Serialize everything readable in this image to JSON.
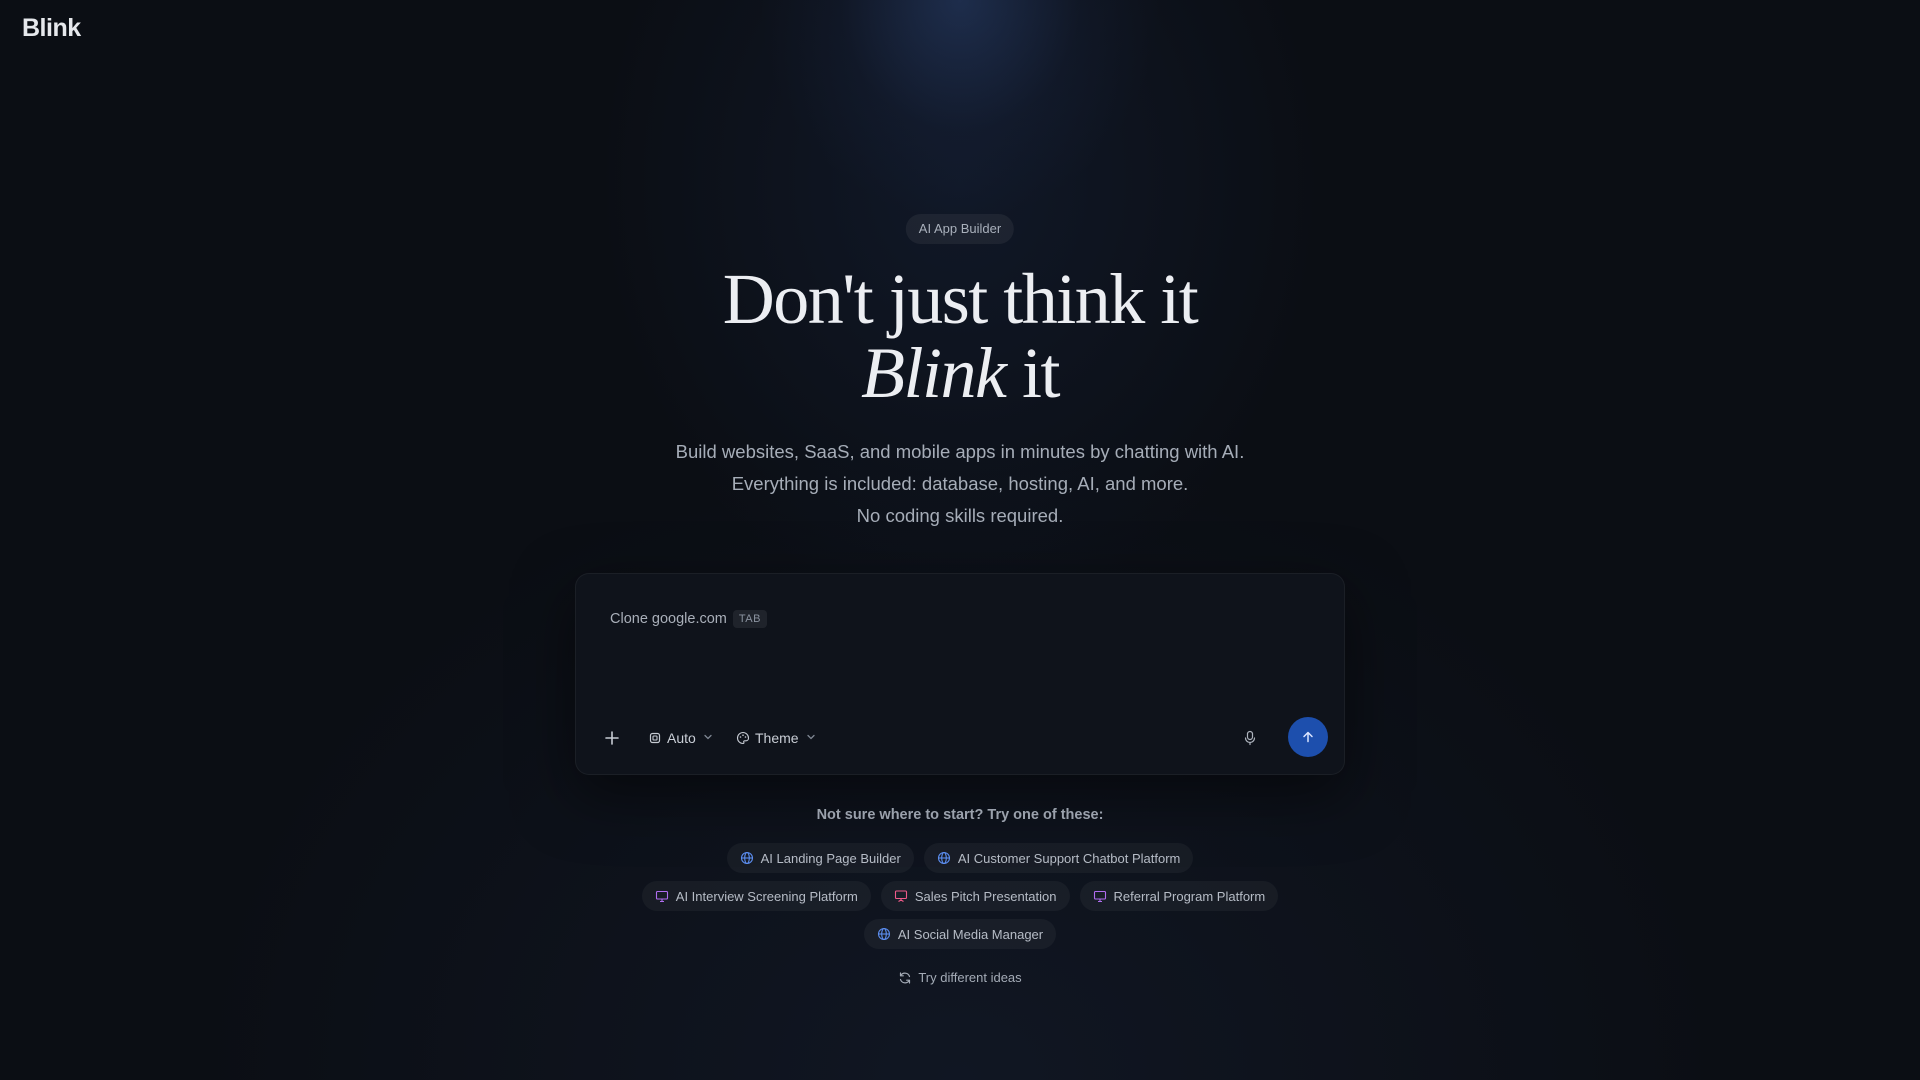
{
  "app": {
    "logo": "Blink"
  },
  "hero": {
    "badge": "AI App Builder",
    "headline_line1": "Don't just think it",
    "headline_line2_italic": "Blink",
    "headline_line2_rest": " it",
    "subtitle_lines": [
      "Build websites, SaaS, and mobile apps in minutes by chatting with AI.",
      "Everything is included: database, hosting, AI, and more.",
      "No coding skills required."
    ]
  },
  "composer": {
    "placeholder": "Clone google.com",
    "tab_hint": "TAB",
    "model_label": "Auto",
    "theme_label": "Theme",
    "accent_color": "#1d4fad",
    "icons": [
      "plus-icon",
      "cpu-icon",
      "palette-icon",
      "microphone-icon",
      "arrow-up-icon"
    ]
  },
  "suggestions": {
    "title": "Not sure where to start? Try one of these:",
    "rows": [
      [
        {
          "label": "AI Landing Page Builder",
          "icon": "globe-icon",
          "icon_color": "#5b8def"
        },
        {
          "label": "AI Customer Support Chatbot Platform",
          "icon": "globe-icon",
          "icon_color": "#5b8def"
        }
      ],
      [
        {
          "label": "AI Interview Screening Platform",
          "icon": "monitor-icon",
          "icon_color": "#b06df0"
        },
        {
          "label": "Sales Pitch Presentation",
          "icon": "presentation-icon",
          "icon_color": "#f05a8a"
        },
        {
          "label": "Referral Program Platform",
          "icon": "monitor-icon",
          "icon_color": "#b06df0"
        }
      ],
      [
        {
          "label": "AI Social Media Manager",
          "icon": "globe-icon",
          "icon_color": "#5b8def"
        }
      ]
    ],
    "refresh_label": "Try different ideas"
  }
}
